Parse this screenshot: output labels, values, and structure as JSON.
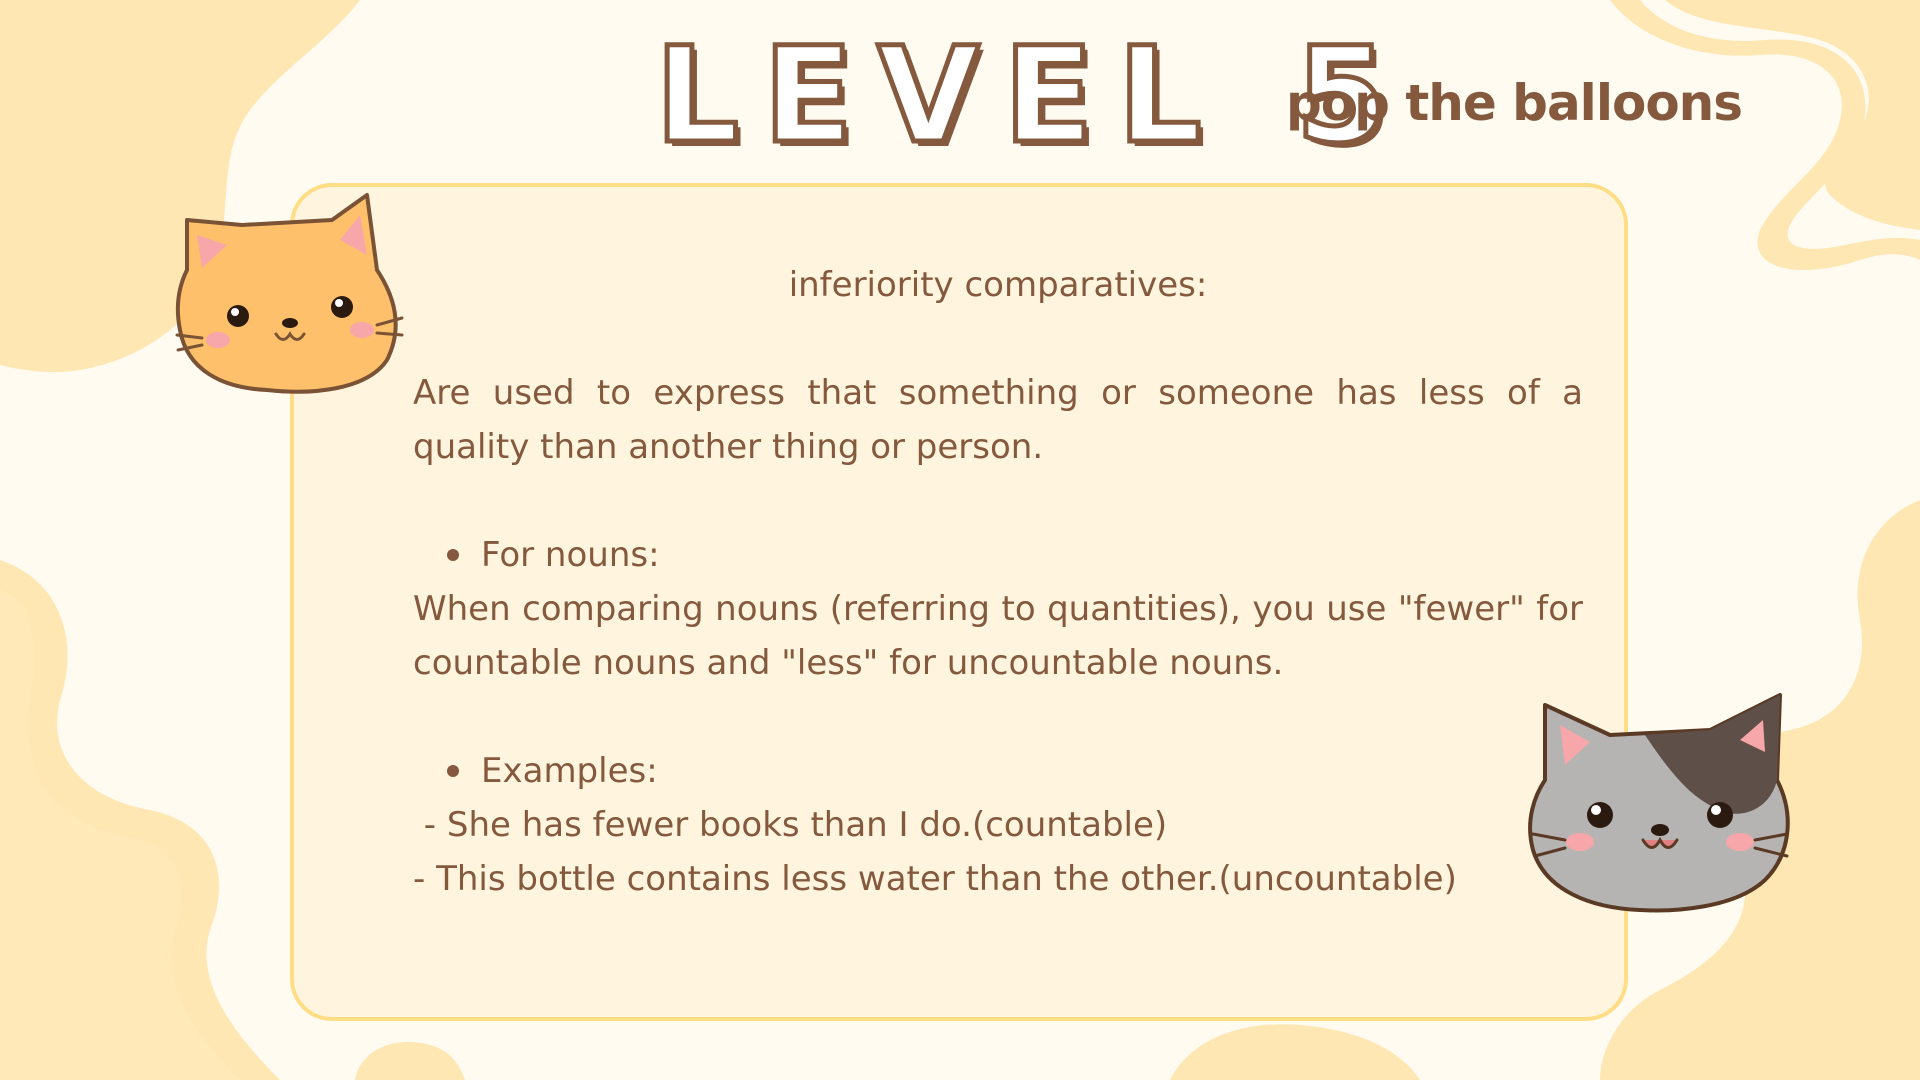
{
  "title": {
    "level": "LEVEL 5",
    "subtitle": "pop the balloons"
  },
  "card": {
    "heading": "inferiority comparatives:",
    "intro": "Are used to express that something or someone has less of a quality than another thing or person.",
    "bullet_nouns": "For nouns:",
    "nouns_text": "When comparing nouns (referring to quantities), you use \"fewer\" for countable nouns and \"less\" for uncountable nouns.",
    "bullet_examples": "Examples:",
    "example_1": " - She has fewer books than I do.(countable)",
    "example_2": "- This bottle contains less water than the other.(uncountable)"
  },
  "decorations": {
    "cat_top_left": "orange-cat-icon",
    "cat_bottom_right": "gray-cat-icon"
  },
  "colors": {
    "background": "#fffbf1",
    "blob": "#ffe7b3",
    "card_fill": "#fff5de",
    "card_border": "#ffdd85",
    "text_brown": "#84593e"
  }
}
